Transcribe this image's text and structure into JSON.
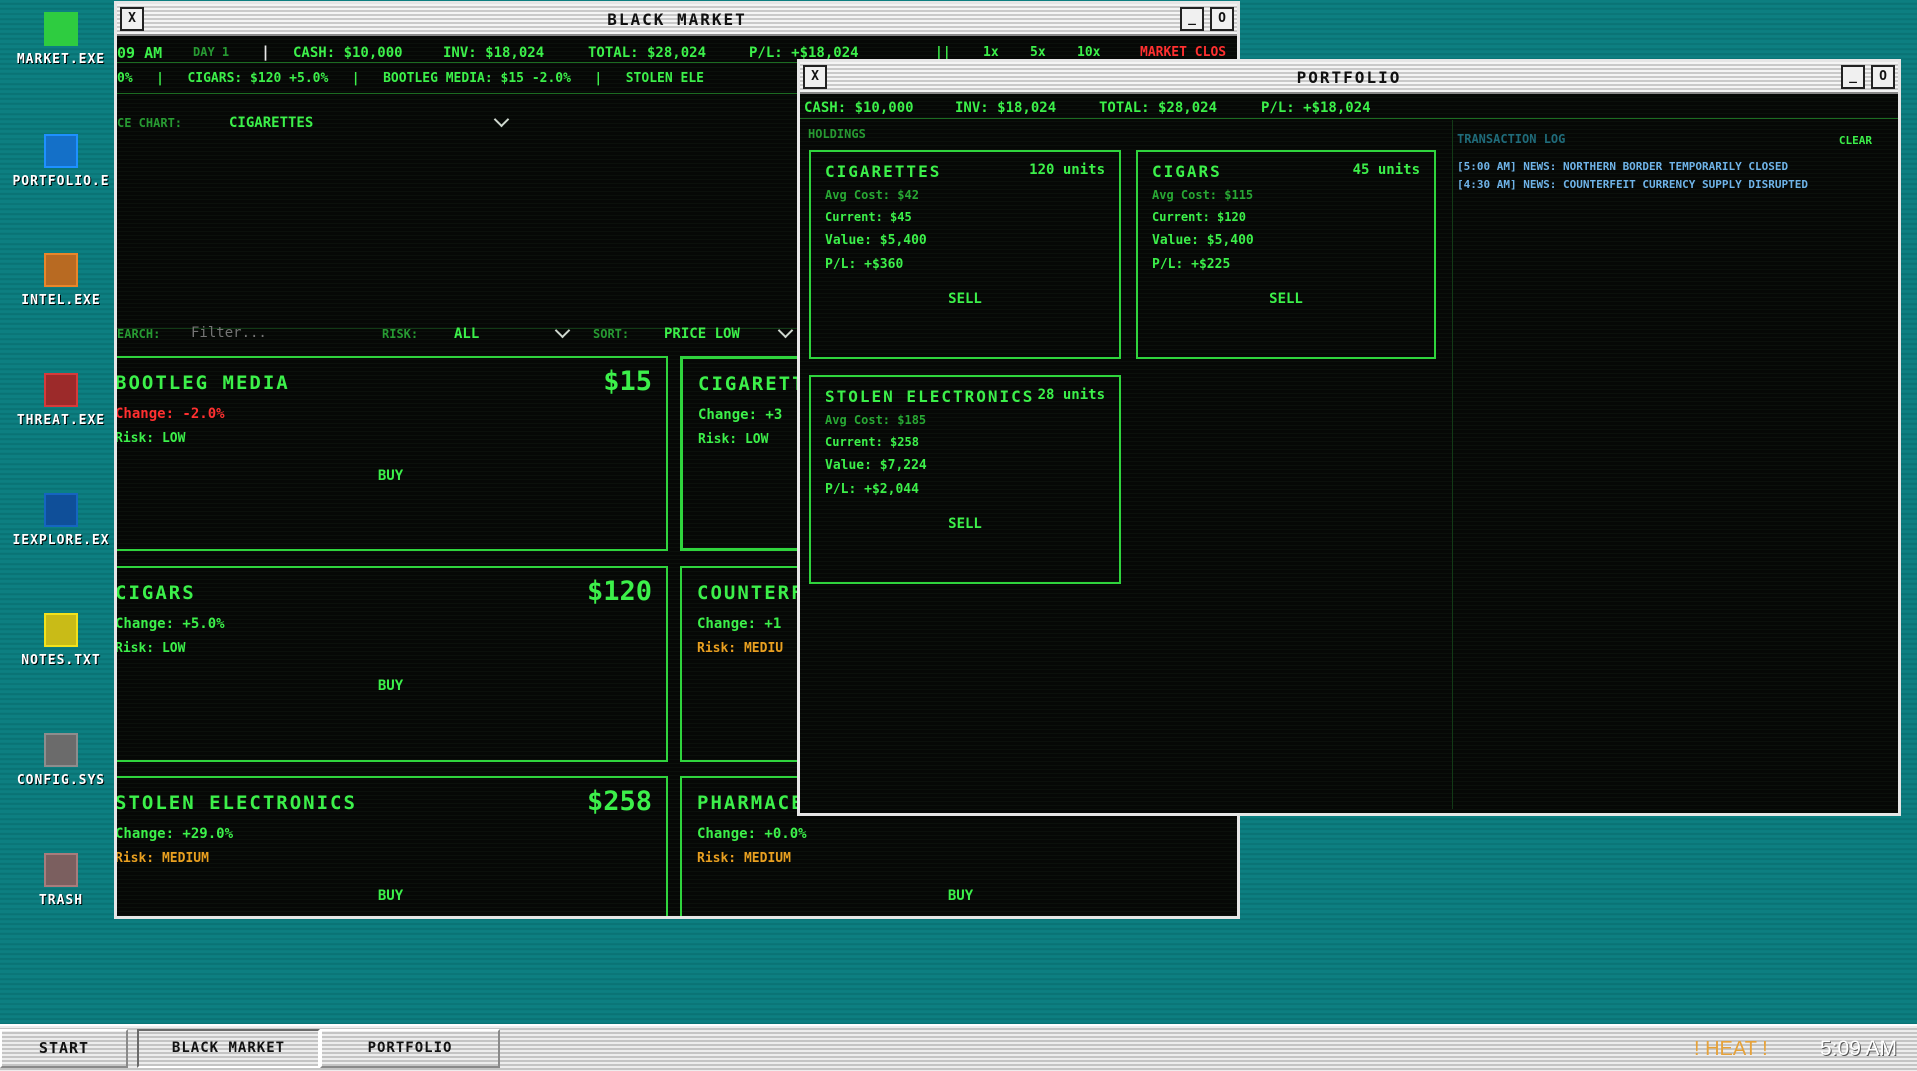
{
  "desktop": {
    "icons": [
      {
        "label": "MARKET.EXE",
        "color": "#2ecc40"
      },
      {
        "label": "PORTFOLIO.E",
        "color": "#1e90ff"
      },
      {
        "label": "INTEL.EXE",
        "color": "#e8862a"
      },
      {
        "label": "THREAT.EXE",
        "color": "#d63a3a"
      },
      {
        "label": "IEXPLORE.EX",
        "color": "#1565c0"
      },
      {
        "label": "NOTES.TXT",
        "color": "#f2e21c"
      },
      {
        "label": "CONFIG.SYS",
        "color": "#8d8d8d"
      },
      {
        "label": "TRASH",
        "color": "#a77c7c"
      }
    ]
  },
  "market_window": {
    "title": "BLACK MARKET",
    "close": "X",
    "minimize": "_",
    "maximize": "O",
    "status": {
      "time": "09 AM",
      "day": "DAY 1",
      "sep": "|",
      "cash": "CASH: $10,000",
      "inv": "INV: $18,024",
      "total": "TOTAL: $28,024",
      "pl": "P/L: +$18,024",
      "pause": "||",
      "speed1": "1x",
      "speed5": "5x",
      "speed10": "10x",
      "market_state": "MARKET CLOS"
    },
    "ticker": "0%   |   CIGARS: $120 +5.0%   |   BOOTLEG MEDIA: $15 -2.0%   |   STOLEN ELE",
    "chart_label": "CE CHART:",
    "chart_select": "CIGARETTES",
    "search_label": "EARCH:",
    "search_placeholder": "Filter...",
    "risk_label": "RISK:",
    "risk_value": "ALL",
    "sort_label": "SORT:",
    "sort_value": "PRICE LOW",
    "products": [
      {
        "name": "BOOTLEG MEDIA",
        "price": "$15",
        "change": "Change: -2.0%",
        "risk": "Risk: LOW",
        "buy": "BUY"
      },
      {
        "name": "CIGARETT",
        "price": "",
        "change": "Change: +3",
        "risk": "Risk: LOW",
        "buy": ""
      },
      {
        "name": "CIGARS",
        "price": "$120",
        "change": "Change: +5.0%",
        "risk": "Risk: LOW",
        "buy": "BUY"
      },
      {
        "name": "COUNTERF",
        "price": "",
        "change": "Change: +1",
        "risk": "Risk: MEDIU",
        "buy": ""
      },
      {
        "name": "STOLEN ELECTRONICS",
        "price": "$258",
        "change": "Change: +29.0%",
        "risk": "Risk: MEDIUM",
        "buy": "BUY"
      },
      {
        "name": "PHARMACE",
        "price": "",
        "change": "Change: +0.0%",
        "risk": "Risk: MEDIUM",
        "buy": "BUY"
      }
    ]
  },
  "portfolio_window": {
    "title": "PORTFOLIO",
    "close": "X",
    "minimize": "_",
    "maximize": "O",
    "summary": {
      "cash": "CASH: $10,000",
      "inv": "INV: $18,024",
      "total": "TOTAL: $28,024",
      "pl": "P/L: +$18,024"
    },
    "holdings_label": "HOLDINGS",
    "holdings": [
      {
        "name": "CIGARETTES",
        "units": "120 units",
        "avg": "Avg Cost: $42",
        "current": "Current: $45",
        "value": "Value: $5,400",
        "pl": "P/L: +$360",
        "sell": "SELL"
      },
      {
        "name": "CIGARS",
        "units": "45 units",
        "avg": "Avg Cost: $115",
        "current": "Current: $120",
        "value": "Value: $5,400",
        "pl": "P/L: +$225",
        "sell": "SELL"
      },
      {
        "name": "STOLEN ELECTRONICS",
        "units": "28 units",
        "avg": "Avg Cost: $185",
        "current": "Current: $258",
        "value": "Value: $7,224",
        "pl": "P/L: +$2,044",
        "sell": "SELL"
      }
    ],
    "log_label": "TRANSACTION LOG",
    "clear": "CLEAR",
    "log": [
      "[5:00 AM] NEWS: NORTHERN BORDER TEMPORARILY CLOSED",
      "[4:30 AM] NEWS: COUNTERFEIT CURRENCY SUPPLY DISRUPTED"
    ]
  },
  "taskbar": {
    "start": "START",
    "items": [
      "BLACK MARKET",
      "PORTFOLIO"
    ],
    "heat": "! HEAT !",
    "clock": "5:09 AM"
  }
}
